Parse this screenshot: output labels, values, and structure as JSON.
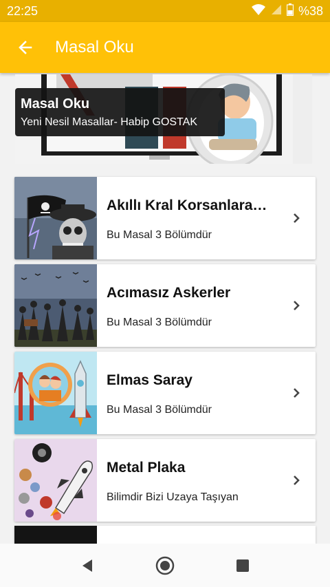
{
  "status_bar": {
    "time": "22:25",
    "battery": "%38"
  },
  "app_bar": {
    "title": "Masal Oku"
  },
  "hero": {
    "title": "Masal Oku",
    "subtitle": "Yeni Nesil Masallar- Habip GOSTAK"
  },
  "stories": [
    {
      "title": "Akıllı Kral Korsanlara…",
      "subtitle": "Bu Masal 3 Bölümdür",
      "image": "pirate-scene"
    },
    {
      "title": "Acımasız Askerler",
      "subtitle": "Bu Masal 3 Bölümdür",
      "image": "soldiers-scene"
    },
    {
      "title": "Elmas Saray",
      "subtitle": "Bu Masal 3 Bölümdür",
      "image": "palace-scene"
    },
    {
      "title": "Metal Plaka",
      "subtitle": "Bilimdir Bizi Uzaya Taşıyan",
      "image": "space-scene"
    }
  ],
  "colors": {
    "status_bar": "#e8b000",
    "app_bar": "#ffc107",
    "background": "#f2f2f2"
  }
}
